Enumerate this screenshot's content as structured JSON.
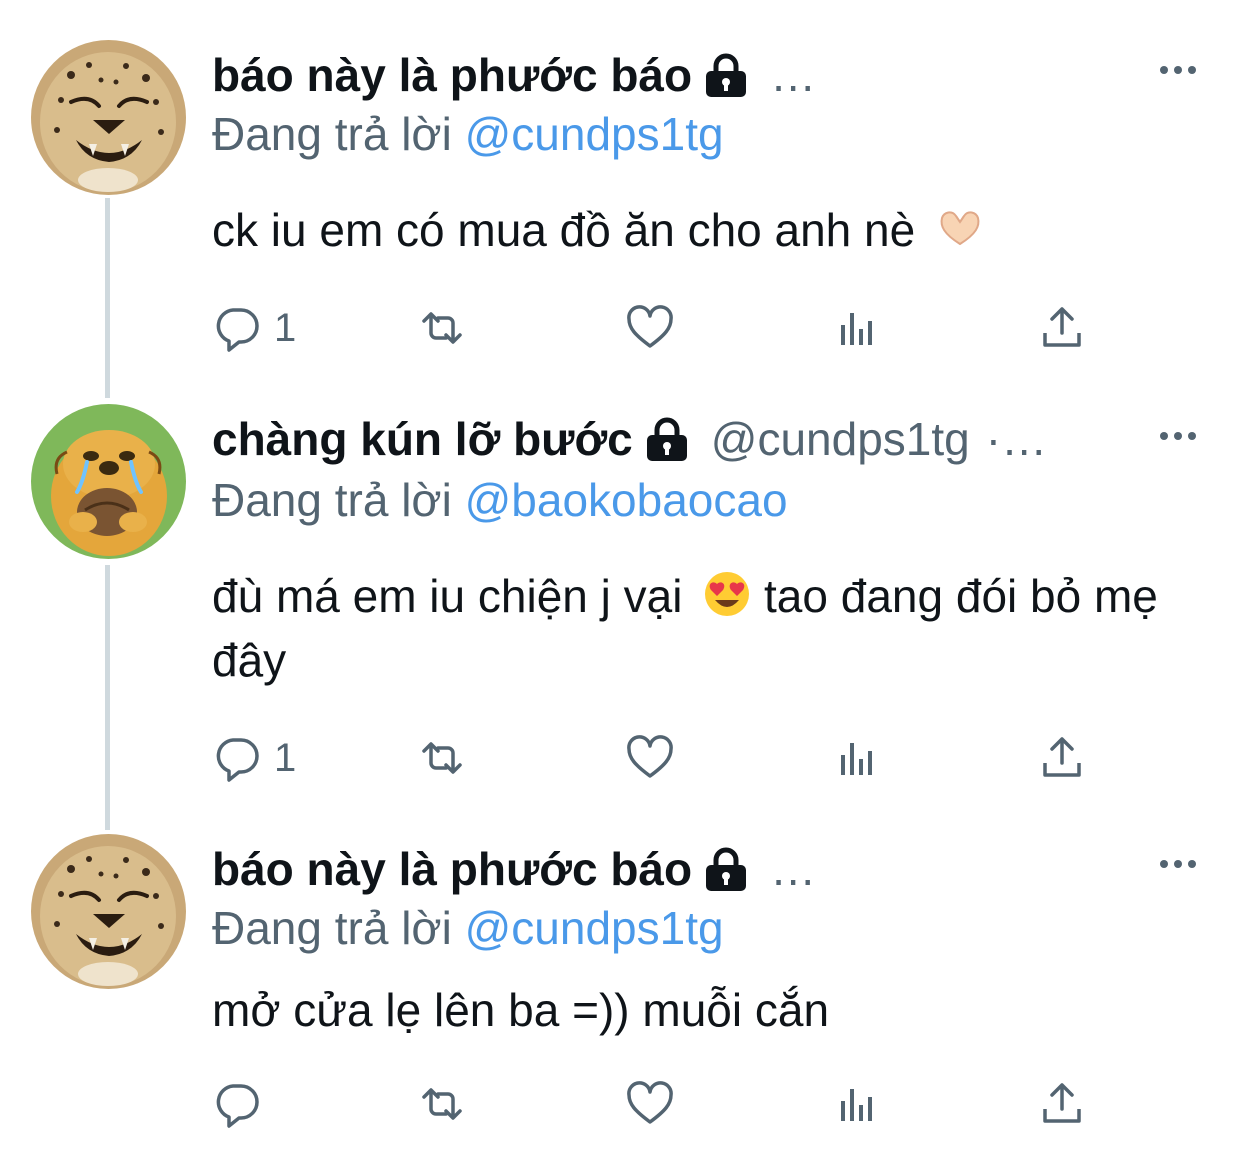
{
  "tweets": [
    {
      "author_name": "báo này là phước báo",
      "handle": "",
      "ellipsis": "…",
      "reply_prefix": "Đang trả lời",
      "reply_mention": "@cundps1tg",
      "text": "ck iu em có mua đồ ăn cho anh nè",
      "emoji": "heart-hands-emoji",
      "reply_count": "1",
      "avatar": "cheetah-avatar"
    },
    {
      "author_name": "chàng kún lỡ bước",
      "handle": "@cundps1tg",
      "ellipsis": "·…",
      "reply_prefix": "Đang trả lời",
      "reply_mention": "@baokobaocao",
      "text_before_emoji": "đù má em iu chiện j vại",
      "emoji": "heart-eyes-emoji",
      "text_after_emoji": " tao đang đói bỏ mẹ đây",
      "reply_count": "1",
      "avatar": "cartoon-dog-avatar"
    },
    {
      "author_name": "báo này là phước báo",
      "handle": "",
      "ellipsis": "…",
      "reply_prefix": "Đang trả lời",
      "reply_mention": "@cundps1tg",
      "text": "mở cửa lẹ lên ba =)) muỗi cắn",
      "reply_count": "",
      "avatar": "cheetah-avatar"
    }
  ],
  "colors": {
    "text": "#0f1419",
    "secondary": "#536471",
    "mention": "#4a99e9",
    "thread_line": "#cfd9de"
  },
  "icons": [
    "lock-icon",
    "more-icon",
    "reply-icon",
    "retweet-icon",
    "like-icon",
    "analytics-icon",
    "share-icon"
  ]
}
